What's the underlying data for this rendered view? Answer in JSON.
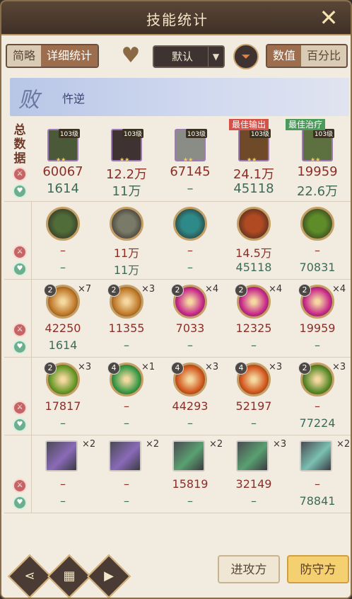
{
  "title": "技能统计",
  "toolbar": {
    "tabs": [
      "简略",
      "详细统计"
    ],
    "sort_value": "默认",
    "value_tabs": [
      "数值",
      "百分比"
    ]
  },
  "result": {
    "seal": "败",
    "team_name": "忤逆"
  },
  "summary_label": [
    "总",
    "数",
    "据"
  ],
  "heroes": [
    {
      "level": "103级",
      "tag": "",
      "damage": "60067",
      "heal": "1614",
      "color": "#4a5a38"
    },
    {
      "level": "103级",
      "tag": "",
      "damage": "12.2万",
      "heal": "11万",
      "color": "#3e3232"
    },
    {
      "level": "103级",
      "tag": "",
      "damage": "67145",
      "heal": "–",
      "color": "#8a8c86"
    },
    {
      "level": "103级",
      "tag": "最佳输出",
      "damage": "24.1万",
      "heal": "45118",
      "color": "#6e4a28"
    },
    {
      "level": "103级",
      "tag": "最佳治疗",
      "damage": "19959",
      "heal": "22.6万",
      "color": "#5c7040"
    }
  ],
  "tags_colors": {
    "best_damage": "#d65048",
    "best_heal": "#4a9a5a"
  },
  "rows": [
    {
      "kind": "hero",
      "cells": [
        {
          "damage": "–",
          "heal": "–",
          "color": "#506c38"
        },
        {
          "damage": "11万",
          "heal": "11万",
          "color": "#7a7a68"
        },
        {
          "damage": "–",
          "heal": "–",
          "color": "#2e8a88"
        },
        {
          "damage": "14.5万",
          "heal": "45118",
          "color": "#b04a22"
        },
        {
          "damage": "–",
          "heal": "70831",
          "color": "#5e8c28"
        }
      ]
    },
    {
      "kind": "skill",
      "cells": [
        {
          "lvl": "2",
          "count": "×7",
          "damage": "42250",
          "heal": "1614",
          "color": "#c07a2a"
        },
        {
          "lvl": "2",
          "count": "×3",
          "damage": "11355",
          "heal": "–",
          "color": "#c07a2a"
        },
        {
          "lvl": "2",
          "count": "×4",
          "damage": "7033",
          "heal": "–",
          "color": "#c82a8a"
        },
        {
          "lvl": "2",
          "count": "×4",
          "damage": "12325",
          "heal": "–",
          "color": "#c82a8a"
        },
        {
          "lvl": "2",
          "count": "×4",
          "damage": "19959",
          "heal": "–",
          "color": "#c82a8a"
        }
      ]
    },
    {
      "kind": "skill",
      "cells": [
        {
          "lvl": "2",
          "count": "×3",
          "damage": "17817",
          "heal": "–",
          "color": "#6a9a28"
        },
        {
          "lvl": "4",
          "count": "×1",
          "damage": "–",
          "heal": "–",
          "color": "#3a9a46"
        },
        {
          "lvl": "4",
          "count": "×3",
          "damage": "44293",
          "heal": "–",
          "color": "#d2581e"
        },
        {
          "lvl": "4",
          "count": "×3",
          "damage": "52197",
          "heal": "–",
          "color": "#d2581e"
        },
        {
          "lvl": "2",
          "count": "×3",
          "damage": "–",
          "heal": "77224",
          "color": "#5a8a28"
        }
      ]
    },
    {
      "kind": "item",
      "cells": [
        {
          "count": "×2",
          "damage": "–",
          "heal": "–",
          "color": "#8a6ab8"
        },
        {
          "count": "×2",
          "damage": "–",
          "heal": "–",
          "color": "#8a6ab8"
        },
        {
          "count": "×2",
          "damage": "15819",
          "heal": "–",
          "color": "#5aa070"
        },
        {
          "count": "×3",
          "damage": "32149",
          "heal": "–",
          "color": "#5aa070"
        },
        {
          "count": "×2",
          "damage": "–",
          "heal": "78841",
          "color": "#7ac0b0"
        }
      ]
    }
  ],
  "bottom": {
    "attack_tab": "进攻方",
    "defense_tab": "防守方",
    "icons": [
      "share-icon",
      "replay-frame-icon",
      "video-icon"
    ]
  }
}
